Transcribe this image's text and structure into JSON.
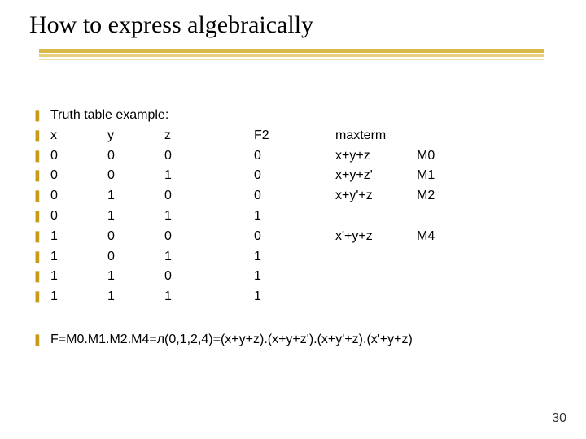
{
  "title": "How to express algebraically",
  "intro": "Truth table example:",
  "headers": {
    "x": "x",
    "y": "y",
    "z": "z",
    "f": "F2",
    "m": "maxterm",
    "n": ""
  },
  "rows": [
    {
      "x": "0",
      "y": "0",
      "z": "0",
      "f": "0",
      "m": "x+y+z",
      "n": "M0"
    },
    {
      "x": "0",
      "y": "0",
      "z": "1",
      "f": "0",
      "m": "x+y+z'",
      "n": "M1"
    },
    {
      "x": "0",
      "y": "1",
      "z": "0",
      "f": "0",
      "m": "x+y'+z",
      "n": "M2"
    },
    {
      "x": "0",
      "y": "1",
      "z": "1",
      "f": "1",
      "m": "",
      "n": ""
    },
    {
      "x": "1",
      "y": "0",
      "z": "0",
      "f": "0",
      "m": "x'+y+z",
      "n": "M4"
    },
    {
      "x": "1",
      "y": "0",
      "z": "1",
      "f": "1",
      "m": "",
      "n": ""
    },
    {
      "x": "1",
      "y": "1",
      "z": "0",
      "f": "1",
      "m": "",
      "n": ""
    },
    {
      "x": "1",
      "y": "1",
      "z": "1",
      "f": "1",
      "m": "",
      "n": ""
    }
  ],
  "summary": "F=M0.M1.M2.M4=л(0,1,2,4)=(x+y+z).(x+y+z').(x+y'+z).(x'+y+z)",
  "page": "30",
  "bullet_glyph": "❚"
}
